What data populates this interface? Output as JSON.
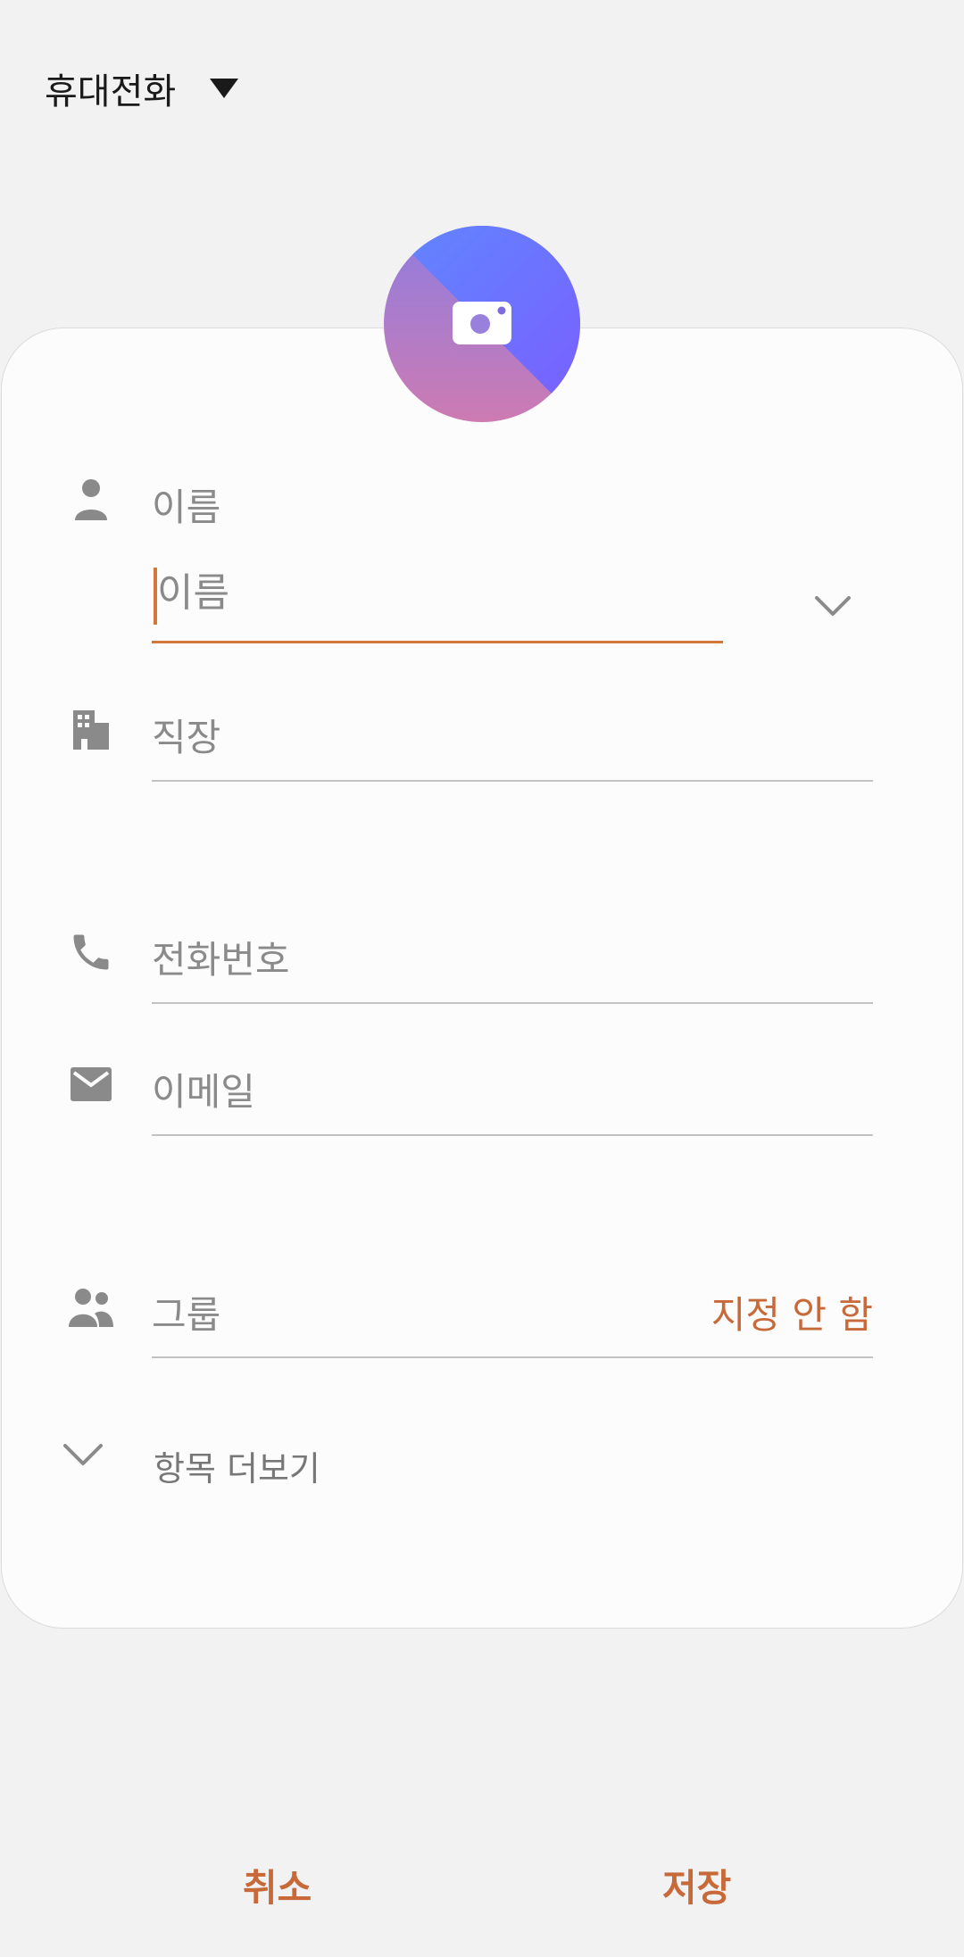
{
  "storage": {
    "label": "휴대전화",
    "icon": "dropdown-caret-icon"
  },
  "avatar": {
    "icon": "camera-icon",
    "gradient": [
      "#5b86ff",
      "#7b63ff",
      "#c97bb0"
    ]
  },
  "fields": {
    "name": {
      "label": "이름",
      "placeholder": "이름",
      "icon": "person-icon",
      "expand_icon": "chevron-down-icon"
    },
    "work": {
      "label": "직장",
      "icon": "building-icon"
    },
    "phone": {
      "label": "전화번호",
      "icon": "phone-icon"
    },
    "email": {
      "label": "이메일",
      "icon": "envelope-icon"
    },
    "group": {
      "label": "그룹",
      "value": "지정 안 함",
      "icon": "people-icon"
    }
  },
  "more_fields": {
    "label": "항목 더보기",
    "icon": "chevron-down-icon"
  },
  "actions": {
    "cancel": "취소",
    "save": "저장"
  },
  "colors": {
    "accent": "#c8693a",
    "input_focus": "#d4773b",
    "icon_gray": "#8a8a8a",
    "background": "#f2f2f2",
    "card": "#fcfcfc"
  }
}
